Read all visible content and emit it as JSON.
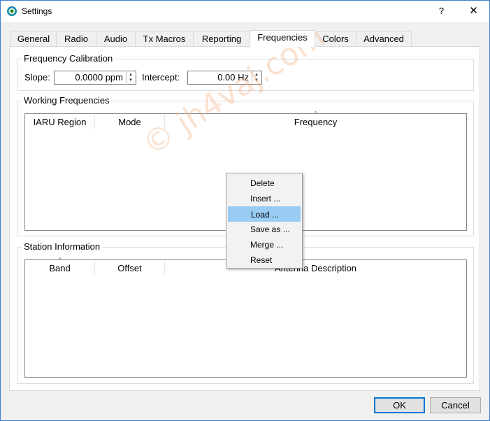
{
  "window": {
    "title": "Settings",
    "help_glyph": "?",
    "close_glyph": "✕"
  },
  "tabs": [
    {
      "label": "General"
    },
    {
      "label": "Radio"
    },
    {
      "label": "Audio"
    },
    {
      "label": "Tx Macros"
    },
    {
      "label": "Reporting"
    },
    {
      "label": "Frequencies",
      "active": true
    },
    {
      "label": "Colors"
    },
    {
      "label": "Advanced"
    }
  ],
  "calibration": {
    "title": "Frequency Calibration",
    "slope_label": "Slope:",
    "slope_value": "0.0000 ppm",
    "intercept_label": "Intercept:",
    "intercept_value": "0.00 Hz"
  },
  "working_frequencies": {
    "title": "Working Frequencies",
    "columns": [
      "IARU Region",
      "Mode",
      "Frequency"
    ]
  },
  "station_info": {
    "title": "Station Information",
    "columns": [
      "Band",
      "Offset",
      "Antenna Description"
    ]
  },
  "context_menu": {
    "items": [
      {
        "label": "Delete"
      },
      {
        "label": "Insert ..."
      },
      {
        "label": "Load ...",
        "highlighted": true
      },
      {
        "label": "Save as ..."
      },
      {
        "label": "Merge ..."
      },
      {
        "label": "Reset"
      }
    ]
  },
  "buttons": {
    "ok": "OK",
    "cancel": "Cancel"
  },
  "watermark": "© jh4vaj.com",
  "colors": {
    "accent": "#0078d7",
    "menu_highlight": "#99ccf3"
  }
}
